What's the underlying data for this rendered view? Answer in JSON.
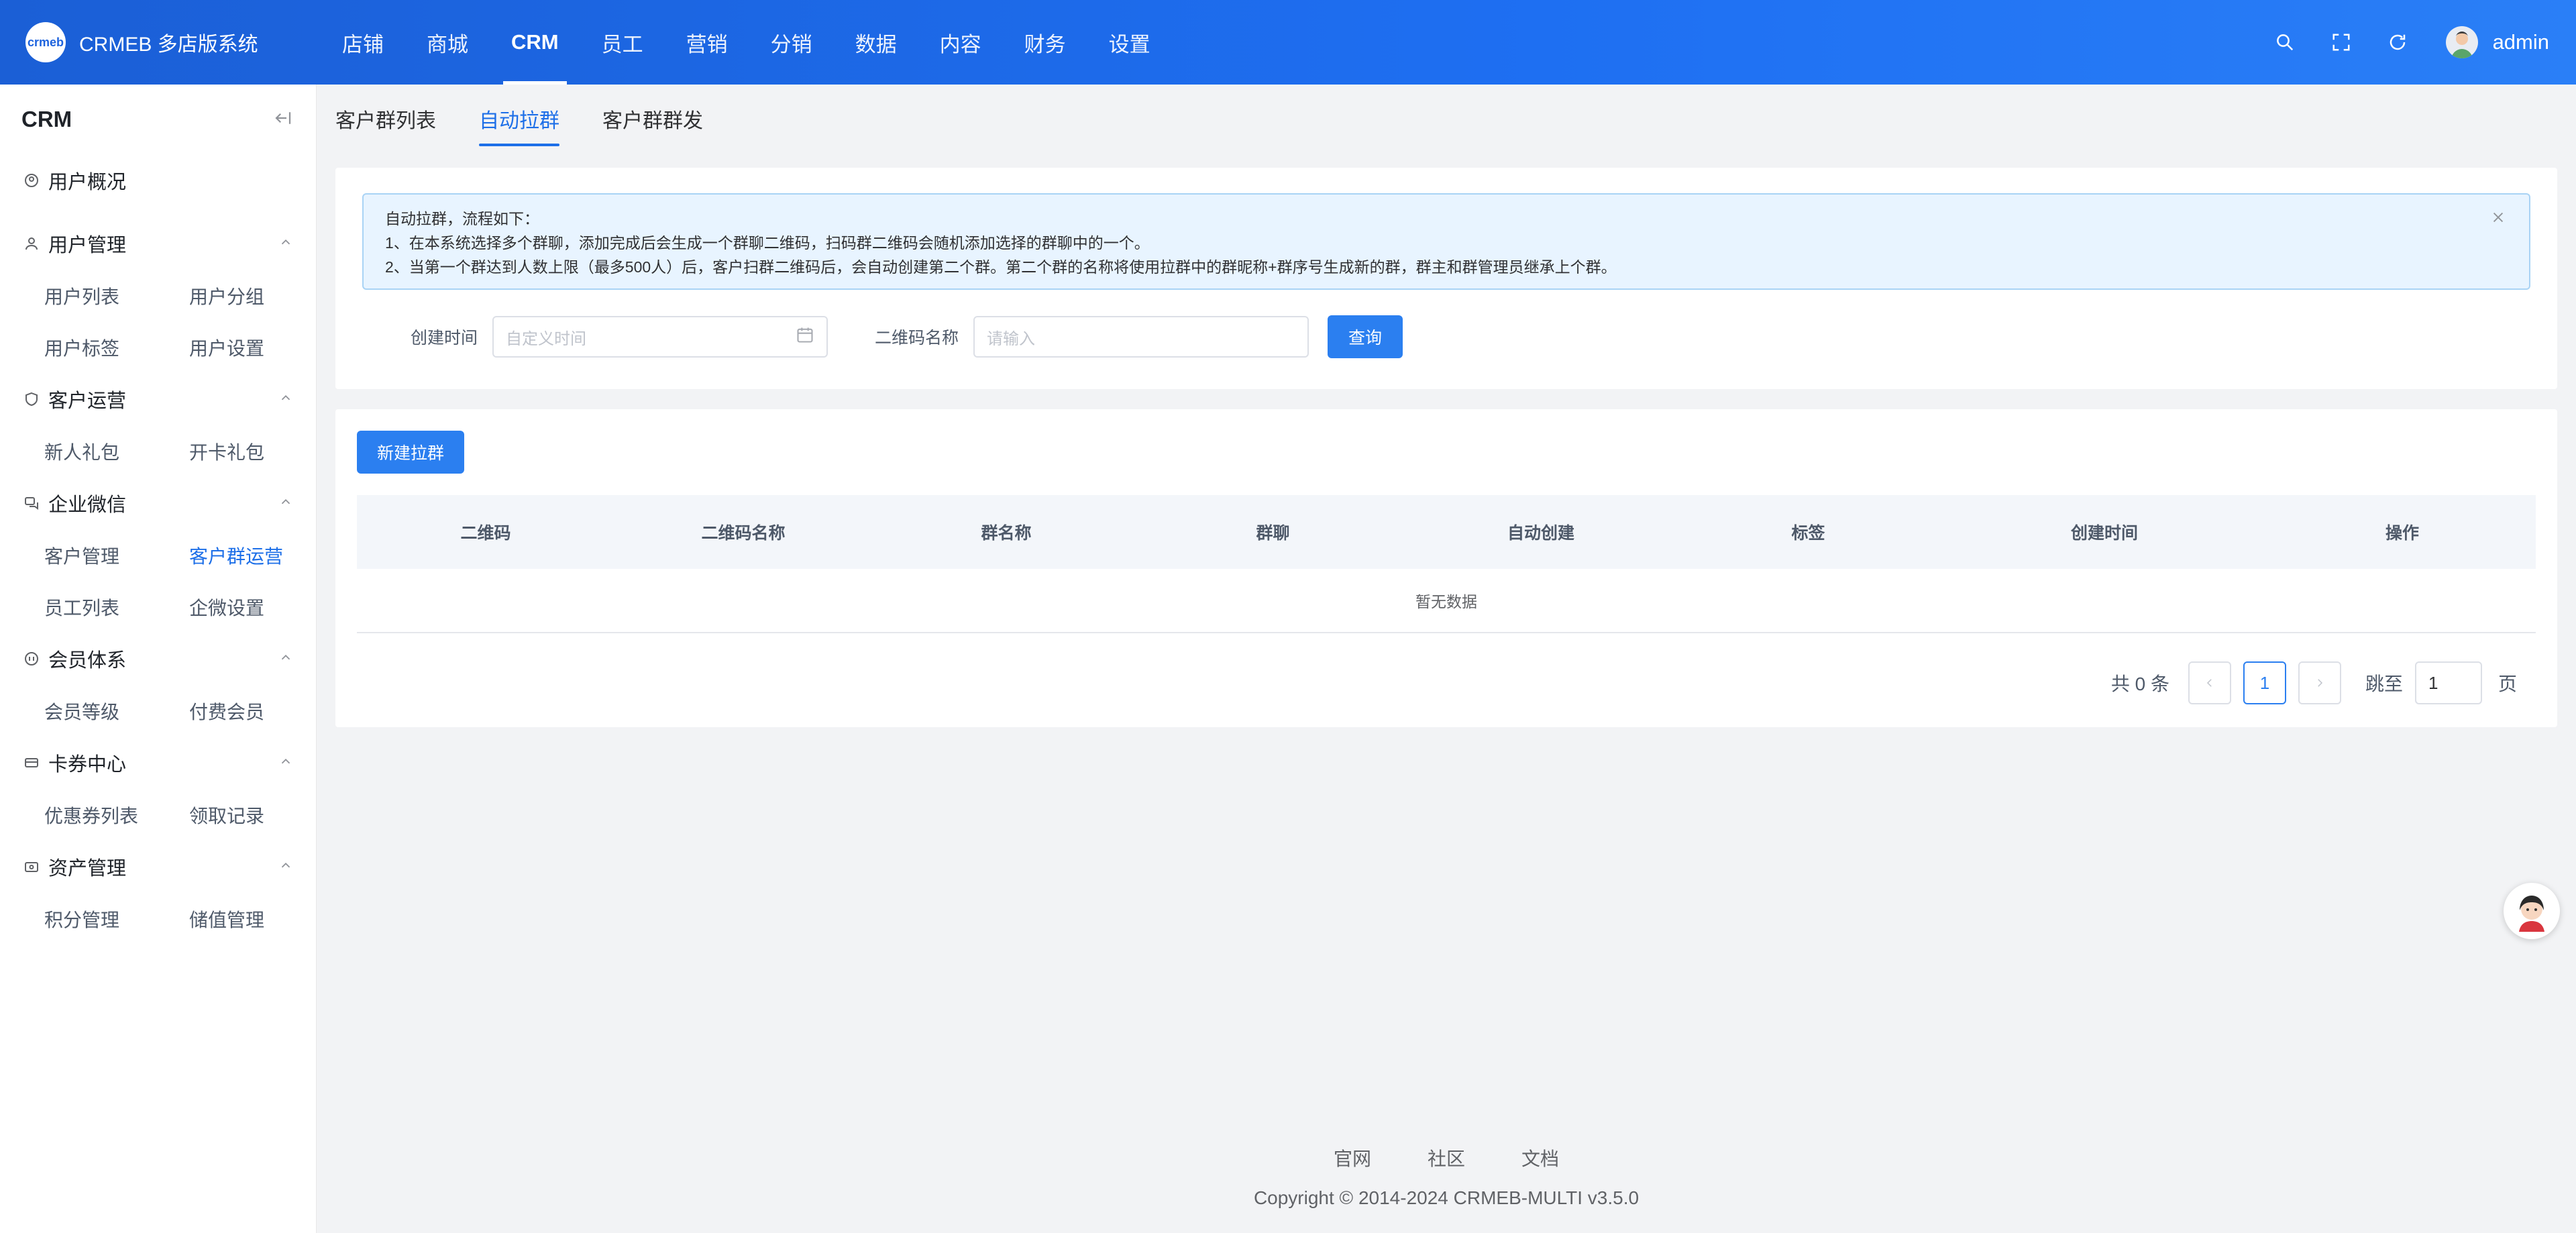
{
  "app": {
    "logo_mark": "crmeb",
    "title": "CRMEB 多店版系统"
  },
  "topnav": [
    {
      "label": "店铺"
    },
    {
      "label": "商城"
    },
    {
      "label": "CRM"
    },
    {
      "label": "员工"
    },
    {
      "label": "营销"
    },
    {
      "label": "分销"
    },
    {
      "label": "数据"
    },
    {
      "label": "内容"
    },
    {
      "label": "财务"
    },
    {
      "label": "设置"
    }
  ],
  "topnav_active": "CRM",
  "header": {
    "user": "admin",
    "icons": [
      "search-icon",
      "fullscreen-icon",
      "refresh-icon"
    ]
  },
  "sidebar": {
    "title": "CRM",
    "overview": "用户概况",
    "groups": [
      {
        "title": "用户管理",
        "icon": "user-icon",
        "items": [
          "用户列表",
          "用户分组",
          "用户标签",
          "用户设置"
        ]
      },
      {
        "title": "客户运营",
        "icon": "shield-icon",
        "items": [
          "新人礼包",
          "开卡礼包"
        ]
      },
      {
        "title": "企业微信",
        "icon": "chat-icon",
        "items": [
          "客户管理",
          "客户群运营",
          "员工列表",
          "企微设置"
        ]
      },
      {
        "title": "会员体系",
        "icon": "member-icon",
        "items": [
          "会员等级",
          "付费会员"
        ]
      },
      {
        "title": "卡券中心",
        "icon": "card-icon",
        "items": [
          "优惠券列表",
          "领取记录"
        ]
      },
      {
        "title": "资产管理",
        "icon": "wallet-icon",
        "items": [
          "积分管理",
          "储值管理"
        ]
      }
    ],
    "active_item": "客户群运营"
  },
  "tabs": [
    {
      "label": "客户群列表"
    },
    {
      "label": "自动拉群"
    },
    {
      "label": "客户群群发"
    }
  ],
  "tabs_active": "自动拉群",
  "alert": {
    "line1": "自动拉群，流程如下：",
    "line2": "1、在本系统选择多个群聊，添加完成后会生成一个群聊二维码，扫码群二维码会随机添加选择的群聊中的一个。",
    "line3": "2、当第一个群达到人数上限（最多500人）后，客户扫群二维码后，会自动创建第二个群。第二个群的名称将使用拉群中的群昵称+群序号生成新的群，群主和群管理员继承上个群。"
  },
  "filters": {
    "date_label": "创建时间",
    "date_placeholder": "自定义时间",
    "name_label": "二维码名称",
    "name_placeholder": "请输入",
    "query_button": "查询"
  },
  "actions": {
    "new_button": "新建拉群"
  },
  "table": {
    "columns": [
      "二维码",
      "二维码名称",
      "群名称",
      "群聊",
      "自动创建",
      "标签",
      "创建时间",
      "操作"
    ],
    "empty_text": "暂无数据"
  },
  "pagination": {
    "total": "共 0 条",
    "current": "1",
    "jump_label": "跳至",
    "jump_value": "1",
    "page_suffix": "页"
  },
  "footer": {
    "links": [
      "官网",
      "社区",
      "文档"
    ],
    "copyright": "Copyright © 2014-2024 CRMEB-MULTI v3.5.0"
  },
  "colors": {
    "accent": "#1d6fe8",
    "header": "#1e6ff2",
    "alert_bg": "#e8f4ff"
  }
}
